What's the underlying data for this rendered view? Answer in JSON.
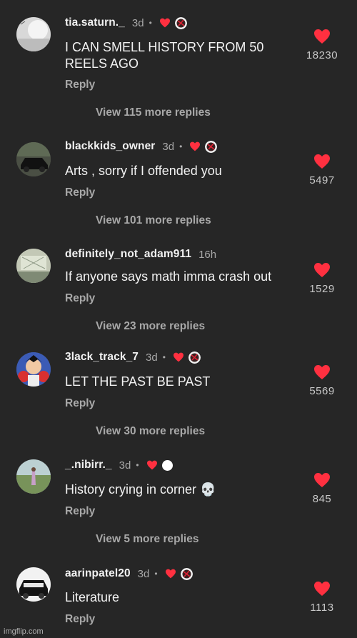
{
  "comments": [
    {
      "username": "tia.saturn._",
      "time": "3d",
      "dot": "•",
      "creator_liked": true,
      "creator_badge": "avatar",
      "text": "I CAN SMELL HISTORY FROM 50 REELS AGO",
      "reply_label": "Reply",
      "view_replies": "View 115 more replies",
      "likes": "18230",
      "avatar_colors": [
        "#cfcfcf",
        "#f4f4f4"
      ]
    },
    {
      "username": "blackkids_owner",
      "time": "3d",
      "dot": "•",
      "creator_liked": true,
      "creator_badge": "avatar",
      "text": "Arts , sorry if I offended you",
      "reply_label": "Reply",
      "view_replies": "View 101 more replies",
      "likes": "5497",
      "avatar_colors": [
        "#3b3f3a",
        "#111111"
      ]
    },
    {
      "username": "definitely_not_adam911",
      "time": "16h",
      "dot": "",
      "creator_liked": false,
      "creator_badge": "",
      "text": "If anyone says math imma crash out",
      "reply_label": "Reply",
      "view_replies": "View 23 more replies",
      "likes": "1529",
      "avatar_colors": [
        "#b9c0a8",
        "#8e9888"
      ]
    },
    {
      "username": "3lack_track_7",
      "time": "3d",
      "dot": "•",
      "creator_liked": true,
      "creator_badge": "avatar",
      "text": "LET THE PAST BE PAST",
      "reply_label": "Reply",
      "view_replies": "View 30 more replies",
      "likes": "5569",
      "avatar_colors": [
        "#2e4f9e",
        "#d33030"
      ]
    },
    {
      "username": "_.nibirr._",
      "time": "3d",
      "dot": "•",
      "creator_liked": true,
      "creator_badge": "white-circle",
      "text": "History crying in corner 💀",
      "reply_label": "Reply",
      "view_replies": "View 5 more replies",
      "likes": "845",
      "avatar_colors": [
        "#b7c9c9",
        "#6f8a55"
      ]
    },
    {
      "username": "aarinpatel20",
      "time": "3d",
      "dot": "•",
      "creator_liked": true,
      "creator_badge": "avatar",
      "text": "Literature",
      "reply_label": "Reply",
      "view_replies": "",
      "likes": "1113",
      "avatar_colors": [
        "#e8e8e8",
        "#1a1a1a"
      ]
    }
  ],
  "watermark": "imgflip.com",
  "colors": {
    "background": "#262626",
    "heart": "#ff3040",
    "muted_text": "#a8a8a8"
  },
  "icons": {
    "like": "heart-icon",
    "creator_like": "small-heart-icon"
  }
}
